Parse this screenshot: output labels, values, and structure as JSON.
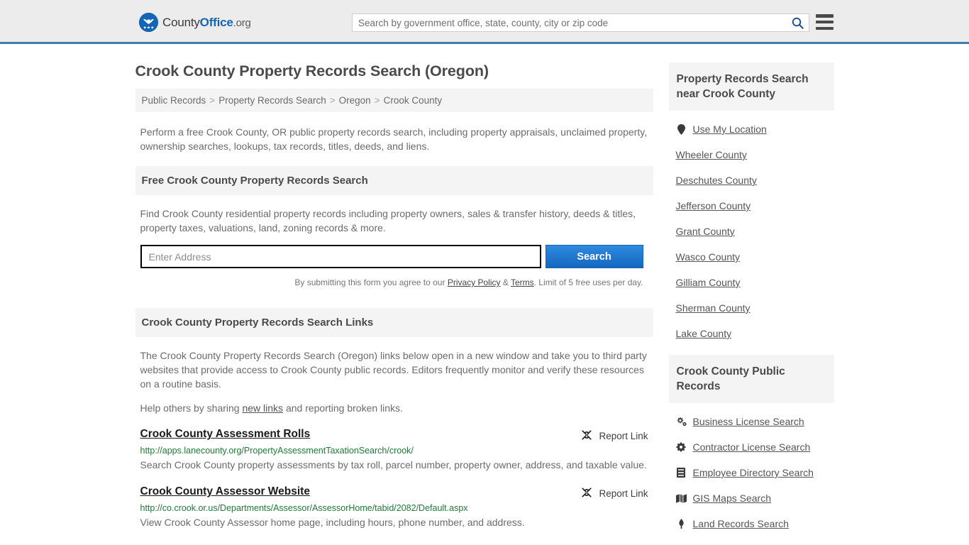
{
  "header": {
    "logo": {
      "part1": "County",
      "part2": "Office",
      "part3": ".org",
      "icon": "eagle-shield-icon"
    },
    "search_placeholder": "Search by government office, state, county, city or zip code",
    "search_value": "",
    "search_icon": "search-icon",
    "menu_icon": "hamburger-menu-icon"
  },
  "main": {
    "page_title": "Crook County Property Records Search (Oregon)",
    "breadcrumb": [
      "Public Records",
      "Property Records Search",
      "Oregon",
      "Crook County"
    ],
    "breadcrumb_separator": ">",
    "intro": "Perform a free Crook County, OR public property records search, including property appraisals, unclaimed property, ownership searches, lookups, tax records, titles, deeds, and liens.",
    "free_search": {
      "heading": "Free Crook County Property Records Search",
      "description": "Find Crook County residential property records including property owners, sales & transfer history, deeds & titles, property taxes, valuations, land, zoning records & more.",
      "input_placeholder": "Enter Address",
      "input_value": "",
      "button_label": "Search",
      "note_prefix": "By submitting this form you agree to our ",
      "note_privacy": "Privacy Policy",
      "note_amp": " & ",
      "note_terms": "Terms",
      "note_suffix": ". Limit of 5 free uses per day."
    },
    "links_section": {
      "heading": "Crook County Property Records Search Links",
      "paragraph1": "The Crook County Property Records Search (Oregon) links below open in a new window and take you to third party websites that provide access to Crook County public records. Editors frequently monitor and verify these resources on a routine basis.",
      "paragraph2_prefix": "Help others by sharing ",
      "paragraph2_link": "new links",
      "paragraph2_suffix": " and reporting broken links.",
      "report_label": "Report Link",
      "report_icon": "broken-link-icon",
      "items": [
        {
          "title": "Crook County Assessment Rolls",
          "url": "http://apps.lanecounty.org/PropertyAssessmentTaxationSearch/crook/",
          "description": "Search Crook County property assessments by tax roll, parcel number, property owner, address, and taxable value."
        },
        {
          "title": "Crook County Assessor Website",
          "url": "http://co.crook.or.us/Departments/Assessor/AssessorHome/tabid/2082/Default.aspx",
          "description": "View Crook County Assessor home page, including hours, phone number, and address."
        }
      ]
    }
  },
  "sidebar": {
    "nearby": {
      "heading": "Property Records Search near Crook County",
      "items": [
        {
          "label": "Use My Location",
          "icon": "map-pin-icon"
        },
        {
          "label": "Wheeler County",
          "icon": ""
        },
        {
          "label": "Deschutes County",
          "icon": ""
        },
        {
          "label": "Jefferson County",
          "icon": ""
        },
        {
          "label": "Grant County",
          "icon": ""
        },
        {
          "label": "Wasco County",
          "icon": ""
        },
        {
          "label": "Gilliam County",
          "icon": ""
        },
        {
          "label": "Sherman County",
          "icon": ""
        },
        {
          "label": "Lake County",
          "icon": ""
        }
      ]
    },
    "public_records": {
      "heading": "Crook County Public Records",
      "items": [
        {
          "label": "Business License Search",
          "icon": "cogs-icon"
        },
        {
          "label": "Contractor License Search",
          "icon": "gear-icon"
        },
        {
          "label": "Employee Directory Search",
          "icon": "id-card-icon"
        },
        {
          "label": "GIS Maps Search",
          "icon": "map-icon"
        },
        {
          "label": "Land Records Search",
          "icon": "landmark-icon"
        }
      ]
    }
  },
  "colors": {
    "brand_blue": "#1565b5",
    "header_bg": "#ececec",
    "header_border": "#3f7cb0",
    "panel_bg": "#f4f4f4",
    "url_green": "#1f7a39",
    "button_blue": "#1467be"
  }
}
